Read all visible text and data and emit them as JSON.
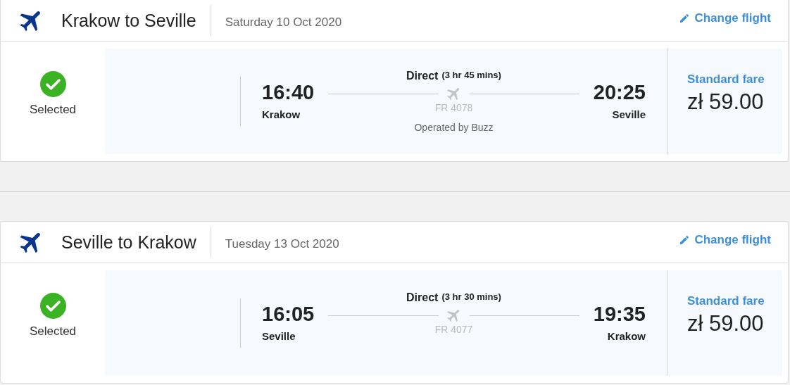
{
  "flights": [
    {
      "route": "Krakow to Seville",
      "date": "Saturday 10 Oct 2020",
      "change_label": "Change flight",
      "selected": true,
      "status": "Selected",
      "departure": {
        "time": "16:40",
        "city": "Krakow"
      },
      "arrival": {
        "time": "20:25",
        "city": "Seville"
      },
      "stops": "Direct",
      "duration": "(3 hr 45 mins)",
      "flight_number": "FR 4078",
      "operator": "Operated by Buzz",
      "fare_name": "Standard fare",
      "price": "zł 59.00"
    },
    {
      "route": "Seville to Krakow",
      "date": "Tuesday 13 Oct 2020",
      "change_label": "Change flight",
      "selected": true,
      "status": "Selected",
      "departure": {
        "time": "16:05",
        "city": "Seville"
      },
      "arrival": {
        "time": "19:35",
        "city": "Krakow"
      },
      "stops": "Direct",
      "duration": "(3 hr 30 mins)",
      "flight_number": "FR 4077",
      "fare_name": "Standard fare",
      "price": "zł 59.00"
    }
  ]
}
